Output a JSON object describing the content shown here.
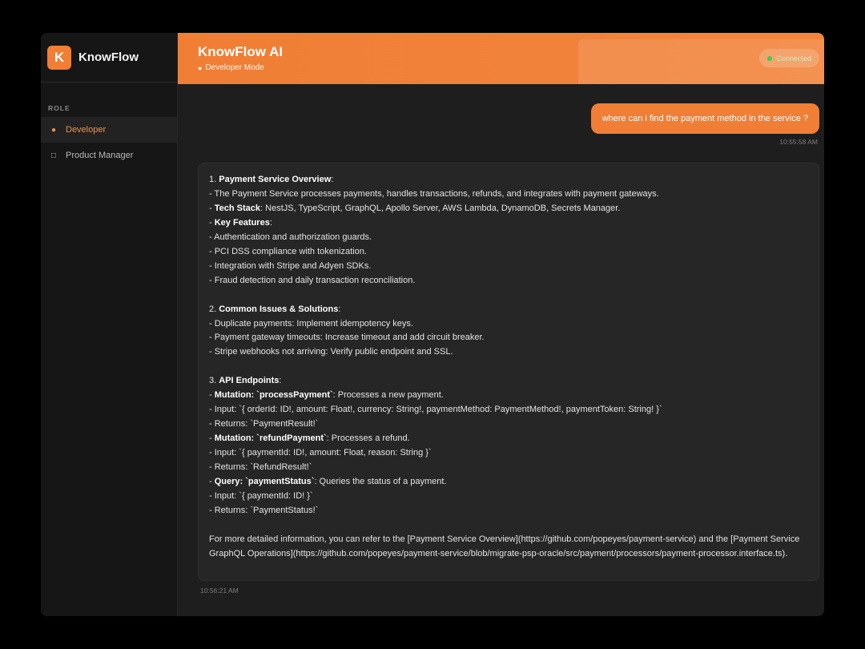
{
  "sidebar": {
    "brand_letter": "K",
    "brand_name": "KnowFlow",
    "section_label": "ROLE",
    "roles": [
      {
        "label": "Developer",
        "icon": "developer-icon",
        "active": true
      },
      {
        "label": "Product Manager",
        "icon": "clipboard-icon",
        "active": false
      }
    ]
  },
  "header": {
    "title": "KnowFlow AI",
    "subtitle": "Developer Mode",
    "status": "Connected"
  },
  "chat": {
    "user_message": "where can i find the payment method in the service ?",
    "user_time": "10:55:58 AM",
    "bot_time": "10:56:21 AM",
    "bot_lines": [
      [
        {
          "t": "1. "
        },
        {
          "t": "Payment Service Overview",
          "b": true
        },
        {
          "t": ":"
        }
      ],
      [
        {
          "t": "- The Payment Service processes payments, handles transactions, refunds, and integrates with payment gateways."
        }
      ],
      [
        {
          "t": "- "
        },
        {
          "t": "Tech Stack",
          "b": true
        },
        {
          "t": ": NestJS, TypeScript, GraphQL, Apollo Server, AWS Lambda, DynamoDB, Secrets Manager."
        }
      ],
      [
        {
          "t": "- "
        },
        {
          "t": "Key Features",
          "b": true
        },
        {
          "t": ":"
        }
      ],
      [
        {
          "t": "- Authentication and authorization guards."
        }
      ],
      [
        {
          "t": "- PCI DSS compliance with tokenization."
        }
      ],
      [
        {
          "t": "- Integration with Stripe and Adyen SDKs."
        }
      ],
      [
        {
          "t": "- Fraud detection and daily transaction reconciliation."
        }
      ],
      [],
      [
        {
          "t": "2. "
        },
        {
          "t": "Common Issues & Solutions",
          "b": true
        },
        {
          "t": ":"
        }
      ],
      [
        {
          "t": "- Duplicate payments: Implement idempotency keys."
        }
      ],
      [
        {
          "t": "- Payment gateway timeouts: Increase timeout and add circuit breaker."
        }
      ],
      [
        {
          "t": "- Stripe webhooks not arriving: Verify public endpoint and SSL."
        }
      ],
      [],
      [
        {
          "t": "3. "
        },
        {
          "t": "API Endpoints",
          "b": true
        },
        {
          "t": ":"
        }
      ],
      [
        {
          "t": "- "
        },
        {
          "t": "Mutation: `processPayment`",
          "b": true
        },
        {
          "t": ": Processes a new payment."
        }
      ],
      [
        {
          "t": "- Input: `{ orderId: ID!, amount: Float!, currency: String!, paymentMethod: PaymentMethod!, paymentToken: String! }`"
        }
      ],
      [
        {
          "t": "- Returns: `PaymentResult!`"
        }
      ],
      [
        {
          "t": "- "
        },
        {
          "t": "Mutation: `refundPayment`",
          "b": true
        },
        {
          "t": ": Processes a refund."
        }
      ],
      [
        {
          "t": "- Input: `{ paymentId: ID!, amount: Float, reason: String }`"
        }
      ],
      [
        {
          "t": "- Returns: `RefundResult!`"
        }
      ],
      [
        {
          "t": "- "
        },
        {
          "t": "Query: `paymentStatus`",
          "b": true
        },
        {
          "t": ": Queries the status of a payment."
        }
      ],
      [
        {
          "t": "- Input: `{ paymentId: ID! }`"
        }
      ],
      [
        {
          "t": "- Returns: `PaymentStatus!`"
        }
      ],
      [],
      [
        {
          "t": "For more detailed information, you can refer to the [Payment Service Overview](https://github.com/popeyes/payment-service) and the [Payment Service GraphQL Operations](https://github.com/popeyes/payment-service/blob/migrate-psp-oracle/src/payment/processors/payment-processor.interface.ts)."
        }
      ]
    ]
  }
}
